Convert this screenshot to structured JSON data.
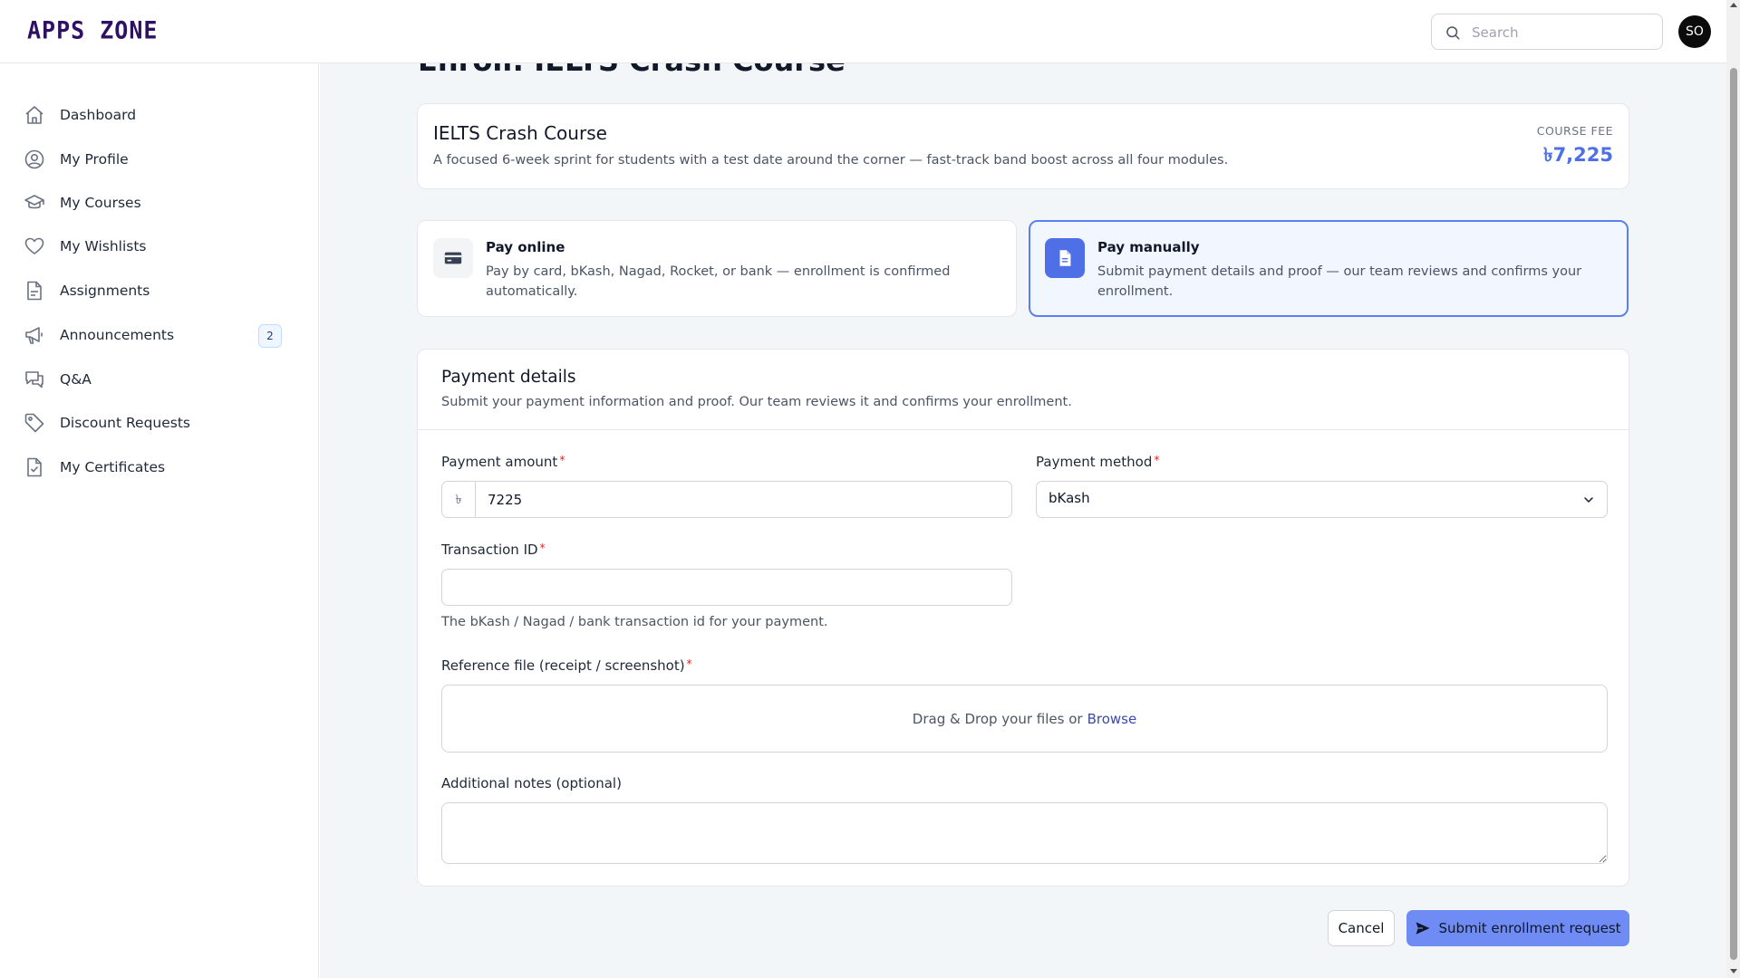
{
  "header": {
    "logo_text": "APPS ZONE",
    "search_placeholder": "Search",
    "avatar_initials": "SO"
  },
  "sidebar": {
    "items": [
      {
        "label": "Dashboard",
        "icon": "home-icon"
      },
      {
        "label": "My Profile",
        "icon": "user-circle-icon"
      },
      {
        "label": "My Courses",
        "icon": "graduation-cap-icon"
      },
      {
        "label": "My Wishlists",
        "icon": "heart-icon"
      },
      {
        "label": "Assignments",
        "icon": "document-icon"
      },
      {
        "label": "Announcements",
        "icon": "megaphone-icon",
        "badge": "2"
      },
      {
        "label": "Q&A",
        "icon": "chat-bubbles-icon"
      },
      {
        "label": "Discount Requests",
        "icon": "tag-icon"
      },
      {
        "label": "My Certificates",
        "icon": "certificate-icon"
      }
    ]
  },
  "page": {
    "title": "Enroll: IELTS Crash Course"
  },
  "course": {
    "title": "IELTS Crash Course",
    "description": "A focused 6-week sprint for students with a test date around the corner — fast-track band boost across all four modules.",
    "fee_label": "COURSE FEE",
    "fee_value": "৳7,225"
  },
  "payment_options": [
    {
      "title": "Pay online",
      "description": "Pay by card, bKash, Nagad, Rocket, or bank — enrollment is confirmed automatically.",
      "icon": "credit-card-icon",
      "selected": false
    },
    {
      "title": "Pay manually",
      "description": "Submit payment details and proof — our team reviews and confirms your enrollment.",
      "icon": "file-icon",
      "selected": true
    }
  ],
  "details": {
    "title": "Payment details",
    "subtitle": "Submit your payment information and proof. Our team reviews it and confirms your enrollment.",
    "amount_label": "Payment amount",
    "amount_prefix": "৳",
    "amount_value": "7225",
    "method_label": "Payment method",
    "method_value": "bKash",
    "txn_label": "Transaction ID",
    "txn_value": "",
    "txn_hint": "The bKash / Nagad / bank transaction id for your payment.",
    "file_label": "Reference file (receipt / screenshot)",
    "dropzone_text": "Drag & Drop your files or",
    "browse_text": "Browse",
    "notes_label": "Additional notes (optional)",
    "notes_value": "",
    "required_mark": "*"
  },
  "actions": {
    "cancel_label": "Cancel",
    "submit_label": "Submit enrollment request"
  },
  "colors": {
    "accent": "#4f6fe6",
    "submit_bg": "#6f8cf5",
    "logo": "#2e1065",
    "required": "#dc2626"
  }
}
